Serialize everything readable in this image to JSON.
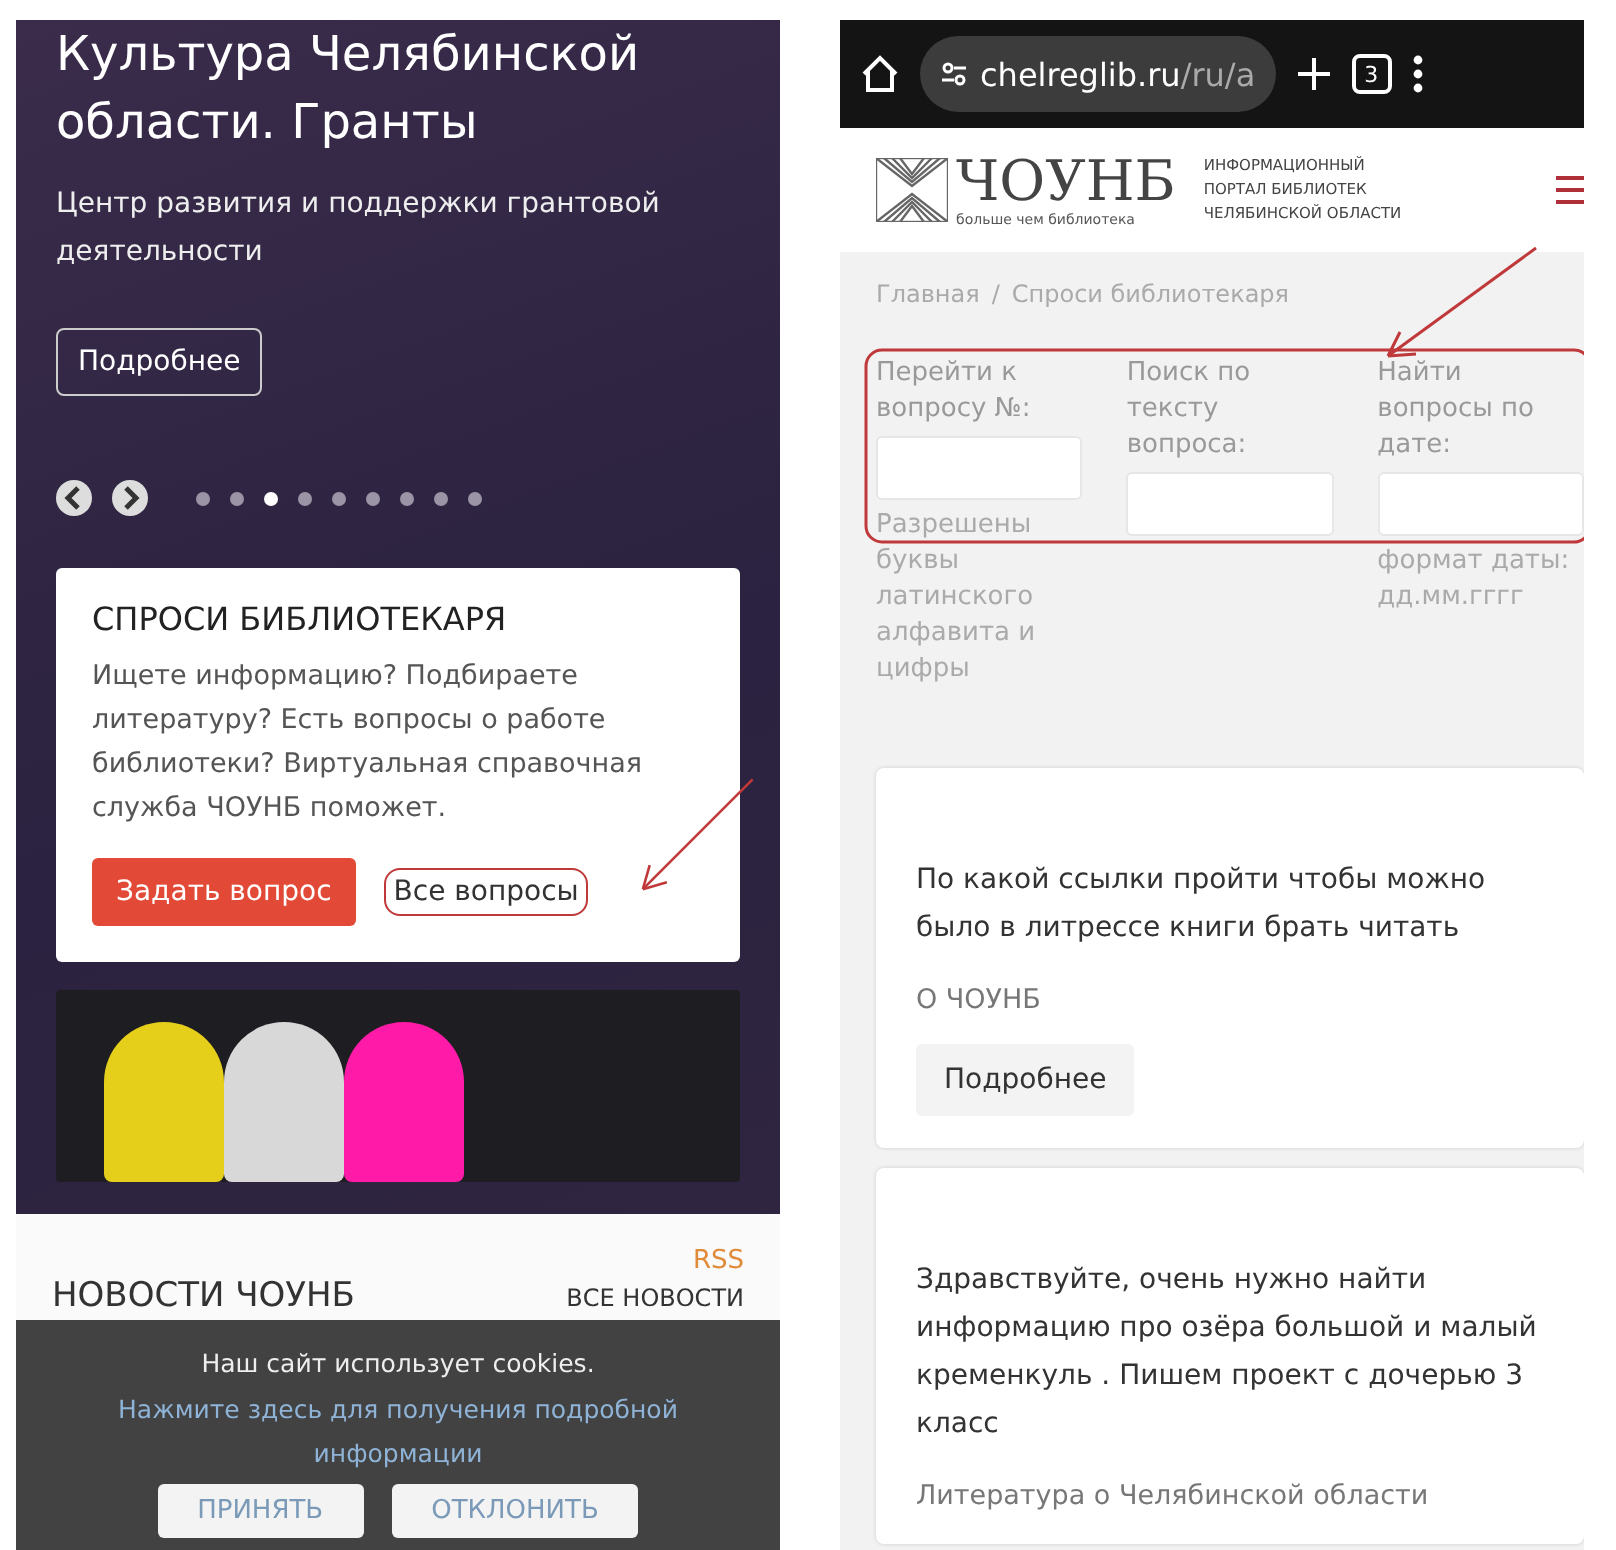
{
  "left_screen": {
    "hero": {
      "title_lines": [
        "Культура Челябинской",
        "области. Гранты"
      ],
      "subtitle": "Центр развития и поддержки грантовой деятельности",
      "button": "Подробнее"
    },
    "carousel_dots": [
      {
        "selected": false
      },
      {
        "selected": false
      },
      {
        "selected": true
      },
      {
        "selected": false
      },
      {
        "selected": false
      },
      {
        "selected": false
      },
      {
        "selected": false
      },
      {
        "selected": false
      },
      {
        "selected": false
      }
    ],
    "ask_card": {
      "title": "СПРОСИ БИБЛИОТЕКАРЯ",
      "text": "Ищете информацию? Подбираете литературу? Есть вопросы о работе библиотеки? Виртуальная справочная служба ЧОУНБ поможет.",
      "primary_button": "Задать вопрос",
      "link": "Все вопросы"
    },
    "news": {
      "rss": "RSS",
      "title": "НОВОСТИ ЧОУНБ",
      "all_link": "ВСЕ НОВОСТИ"
    },
    "cookie_bar": {
      "text": "Наш сайт использует cookies.",
      "link": "Нажмите здесь для получения подробной информации",
      "buttons": [
        "ПРИНЯТЬ",
        "ОТКЛОНИТЬ"
      ]
    }
  },
  "right_screen": {
    "browser": {
      "url_domain": "chelreglib.ru",
      "url_path": "/ru/a",
      "tab_count": "3"
    },
    "header": {
      "logo": "ЧОУНБ",
      "logo_tagline": "больше чем библиотека",
      "portal_lines": [
        "ИНФОРМАЦИОННЫЙ",
        "ПОРТАЛ БИБЛИОТЕК",
        "ЧЕЛЯБИНСКОЙ ОБЛАСТИ"
      ]
    },
    "breadcrumbs": {
      "items": [
        "Главная",
        "Спроси библиотекаря"
      ],
      "separator": "/"
    },
    "filters": [
      {
        "label": "Перейти к вопросу №:",
        "hint": "Разрешены буквы латинского алфавита и цифры"
      },
      {
        "label": "Поиск по тексту вопроса:"
      },
      {
        "label": "Найти вопросы по дате:",
        "hint": "формат даты: дд.мм.гггг"
      }
    ],
    "questions": [
      {
        "text": "По какой ссылки пройти чтобы можно было в литрессе книги брать читать",
        "category": "О ЧОУНБ",
        "button": "Подробнее"
      },
      {
        "text": "Здравствуйте, очень нужно найти информацию про озёра большой и малый кременкуль . Пишем проект с дочерью 3 класс",
        "category": "Литература о Челябинской области"
      }
    ]
  }
}
